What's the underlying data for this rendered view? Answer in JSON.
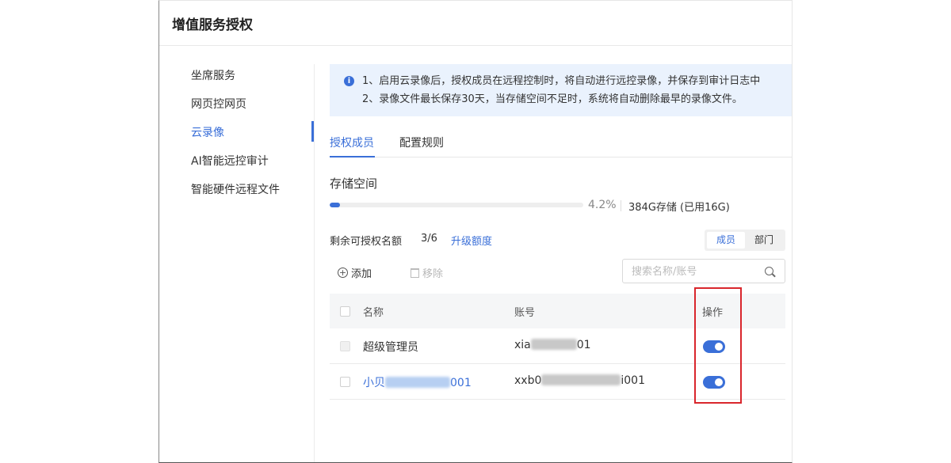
{
  "panel": {
    "title": "增值服务授权"
  },
  "sidebar": {
    "items": [
      {
        "label": "坐席服务",
        "active": false
      },
      {
        "label": "网页控网页",
        "active": false
      },
      {
        "label": "云录像",
        "active": true
      },
      {
        "label": "AI智能远控审计",
        "active": false
      },
      {
        "label": "智能硬件远程文件",
        "active": false
      }
    ]
  },
  "notice": {
    "icon": "info-icon",
    "lines": [
      "1、启用云录像后，授权成员在远程控制时，将自动进行远控录像，并保存到审计日志中",
      "2、录像文件最长保存30天，当存储空间不足时，系统将自动删除最早的录像文件。"
    ]
  },
  "tabs": [
    {
      "label": "授权成员",
      "active": true
    },
    {
      "label": "配置规则",
      "active": false
    }
  ],
  "storage": {
    "title": "存储空间",
    "percent": 4.2,
    "percent_label": "4.2%",
    "info": "384G存储 (已用16G)"
  },
  "quota": {
    "label": "剩余可授权名额",
    "value": "3/6",
    "upgrade_label": "升级额度"
  },
  "segmented": {
    "options": [
      "成员",
      "部门"
    ],
    "selected": "成员"
  },
  "toolbar": {
    "add_label": "添加",
    "remove_label": "移除"
  },
  "search": {
    "placeholder": "搜索名称/账号",
    "value": ""
  },
  "table": {
    "headers": {
      "name": "名称",
      "account": "账号",
      "action": "操作"
    },
    "rows": [
      {
        "name_prefix": "超级管理员",
        "name_suffix": "",
        "account_prefix": "xia",
        "account_suffix": "01",
        "enabled": true
      },
      {
        "name_prefix": "小贝",
        "name_suffix": "001",
        "account_prefix": "xxb0",
        "account_suffix": "i001",
        "enabled": true
      }
    ]
  },
  "colors": {
    "accent": "#3a6fd8",
    "highlight": "#d9262c",
    "notice_bg": "#eaf2fd"
  }
}
